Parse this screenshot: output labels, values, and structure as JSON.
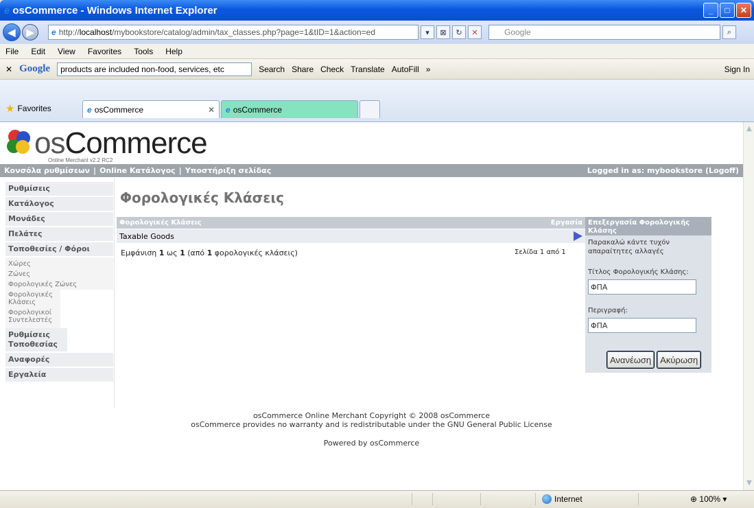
{
  "window": {
    "title": "osCommerce - Windows Internet Explorer"
  },
  "address": {
    "url_prefix": "http://",
    "url_host": "localhost",
    "url_path": "/mybookstore/catalog/admin/tax_classes.php?page=1&tID=1&action=ed",
    "search_placeholder": "Google"
  },
  "menu": [
    "File",
    "Edit",
    "View",
    "Favorites",
    "Tools",
    "Help"
  ],
  "google_toolbar": {
    "logo": "Google",
    "query": "products are included non-food, services, etc",
    "search": "Search",
    "share": "Share",
    "check": "Check",
    "translate": "Translate",
    "autofill": "AutoFill",
    "more": "»",
    "sign_in": "Sign In"
  },
  "favorites": {
    "label": "Favorites"
  },
  "tabs": [
    {
      "label": "osCommerce"
    },
    {
      "label": "osCommerce"
    }
  ],
  "logo": {
    "word_a": "os",
    "word_b": "Commerce",
    "sub": "Online Merchant v2.2 RC2"
  },
  "header": {
    "link1": "Κονσόλα ρυθμίσεων",
    "link2": "Online Κατάλογος",
    "link3": "Υποστήριξη σελίδας",
    "logged": "Logged in as: mybookstore (Logoff)"
  },
  "sidebar": {
    "settings": "Ρυθμίσεις",
    "catalog": "Κατάλογος",
    "modules": "Μονάδες",
    "customers": "Πελάτες",
    "locations": "Τοποθεσίες / Φόροι",
    "sub": [
      "Χώρες",
      "Ζώνες",
      "Φορολογικές Ζώνες",
      "Φορολογικές Κλάσεις",
      "Φορολογικοί Συντελεστές"
    ],
    "location_settings": "Ρυθμίσεις Τοποθεσίας",
    "reports": "Αναφορές",
    "tools": "Εργαλεία"
  },
  "main": {
    "title": "Φορολογικές Κλάσεις",
    "col_class": "Φορολογικές Κλάσεις",
    "col_action": "Εργασία",
    "row1": "Taxable Goods",
    "pager_a": "Εμφάνιση ",
    "pager_from": "1",
    "pager_b": " ως ",
    "pager_to": "1",
    "pager_c": " (από ",
    "pager_total": "1",
    "pager_d": " φορολογικές κλάσεις)",
    "page_info": "Σελίδα 1 από 1"
  },
  "edit": {
    "heading": "Επεξεργασία Φορολογικής Κλάσης",
    "intro": "Παρακαλώ κάντε τυχόν απαραίτητες αλλαγές",
    "title_label": "Τίτλος Φορολογικής Κλάσης:",
    "title_value": "ΦΠΑ",
    "desc_label": "Περιγραφή:",
    "desc_value": "ΦΠΑ",
    "update": "Ανανέωση",
    "cancel": "Ακύρωση"
  },
  "footer": {
    "line1": "osCommerce Online Merchant Copyright © 2008 osCommerce",
    "line2": "osCommerce provides no warranty and is redistributable under the GNU General Public License",
    "powered": "Powered by osCommerce"
  },
  "status": {
    "zone": "Internet",
    "zoom": "100%"
  }
}
